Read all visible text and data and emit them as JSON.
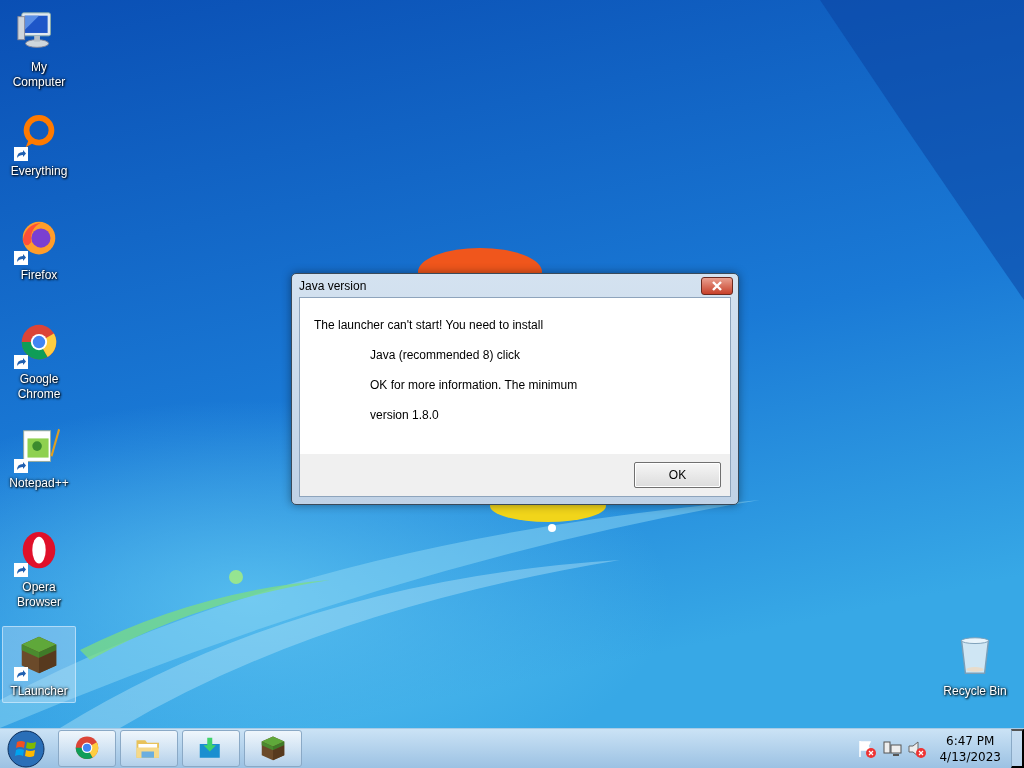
{
  "desktop_icons": [
    {
      "label": "My Computer",
      "kind": "computer",
      "shortcut": false,
      "selected": false
    },
    {
      "label": "Everything",
      "kind": "everything",
      "shortcut": true,
      "selected": false
    },
    {
      "label": "Firefox",
      "kind": "firefox",
      "shortcut": true,
      "selected": false
    },
    {
      "label": "Google Chrome",
      "kind": "chrome",
      "shortcut": true,
      "selected": false
    },
    {
      "label": "Notepad++",
      "kind": "notepad",
      "shortcut": true,
      "selected": false
    },
    {
      "label": "Opera Browser",
      "kind": "opera",
      "shortcut": true,
      "selected": false
    },
    {
      "label": "TLauncher",
      "kind": "grassblock",
      "shortcut": true,
      "selected": true
    }
  ],
  "recycle_bin": {
    "label": "Recycle Bin",
    "kind": "bin",
    "selected": false
  },
  "dialog": {
    "title": "Java version",
    "message_lines": [
      "The launcher can't start! You need to install",
      "Java (recommended 8) click",
      "OK for more information. The minimum",
      "version 1.8.0"
    ],
    "button": "OK"
  },
  "taskbar": {
    "pinned": [
      {
        "kind": "chrome"
      },
      {
        "kind": "folder"
      },
      {
        "kind": "download"
      },
      {
        "kind": "grassblock"
      }
    ],
    "tray": [
      {
        "kind": "flag"
      },
      {
        "kind": "network"
      },
      {
        "kind": "speaker"
      }
    ],
    "clock": {
      "time": "6:47 PM",
      "date": "4/13/2023"
    }
  }
}
